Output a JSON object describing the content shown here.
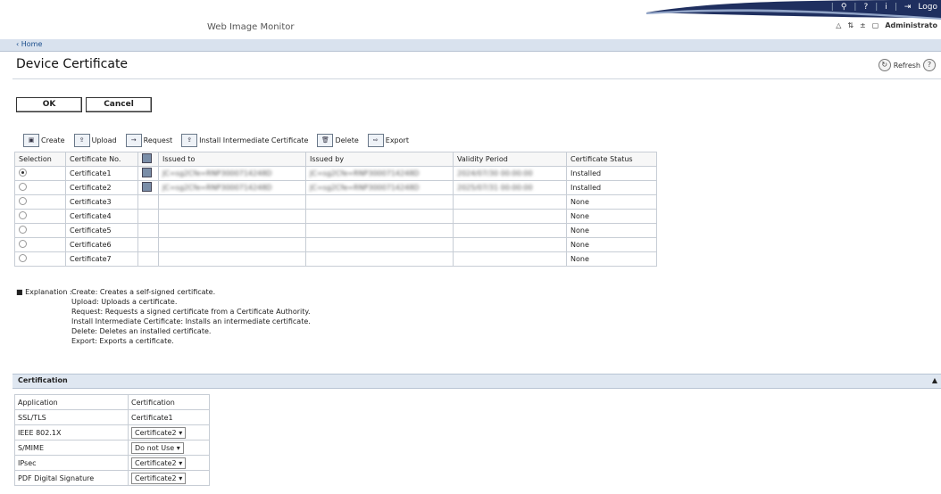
{
  "app": {
    "title": "Web Image Monitor",
    "top_icons": [
      "search-icon",
      "help-icon",
      "info-icon",
      "logout-icon"
    ],
    "logout_label": "Logo",
    "user_label": "Administrato",
    "home_link": "Home"
  },
  "page": {
    "title": "Device Certificate",
    "refresh_label": "Refresh",
    "ok_label": "OK",
    "cancel_label": "Cancel"
  },
  "toolbar": {
    "create": "Create",
    "upload": "Upload",
    "request": "Request",
    "install_intermediate": "Install Intermediate Certificate",
    "delete": "Delete",
    "export": "Export"
  },
  "cert_table": {
    "headers": {
      "selection": "Selection",
      "cert_no": "Certificate No.",
      "issued_to": "Issued to",
      "issued_by": "Issued by",
      "validity": "Validity Period",
      "status": "Certificate Status"
    },
    "rows": [
      {
        "name": "Certificate1",
        "issued_to": "JC=sg2Cfe=RNP3000714248D",
        "issued_by": "JC=sg2Cfe=RNP3000714248D",
        "validity": "2024/07/30 00:00:00",
        "status": "Installed"
      },
      {
        "name": "Certificate2",
        "issued_to": "JC=sg2Cfe=RNP3000714248D",
        "issued_by": "JC=sg2Cfe=RNP3000714248D",
        "validity": "2025/07/31 00:00:00",
        "status": "Installed"
      },
      {
        "name": "Certificate3",
        "issued_to": "",
        "issued_by": "",
        "validity": "",
        "status": "None"
      },
      {
        "name": "Certificate4",
        "issued_to": "",
        "issued_by": "",
        "validity": "",
        "status": "None"
      },
      {
        "name": "Certificate5",
        "issued_to": "",
        "issued_by": "",
        "validity": "",
        "status": "None"
      },
      {
        "name": "Certificate6",
        "issued_to": "",
        "issued_by": "",
        "validity": "",
        "status": "None"
      },
      {
        "name": "Certificate7",
        "issued_to": "",
        "issued_by": "",
        "validity": "",
        "status": "None"
      }
    ]
  },
  "explanation": {
    "label": "■ Explanation :",
    "lines": [
      "Create: Creates a self-signed certificate.",
      "Upload: Uploads a certificate.",
      "Request: Requests a signed certificate from a Certificate Authority.",
      "Install Intermediate Certificate: Installs an intermediate certificate.",
      "Delete: Deletes an installed certificate.",
      "Export: Exports a certificate."
    ]
  },
  "certification": {
    "section_title": "Certification",
    "col_app": "Application",
    "col_cert": "Certification",
    "rows": [
      {
        "app": "SSL/TLS",
        "value": "Certificate1"
      },
      {
        "app": "IEEE 802.1X",
        "value": "Certificate2 ▾"
      },
      {
        "app": "S/MIME",
        "value": "Do not Use ▾"
      },
      {
        "app": "IPsec",
        "value": "Certificate2 ▾"
      },
      {
        "app": "PDF Digital Signature",
        "value": "Certificate2 ▾"
      }
    ]
  }
}
